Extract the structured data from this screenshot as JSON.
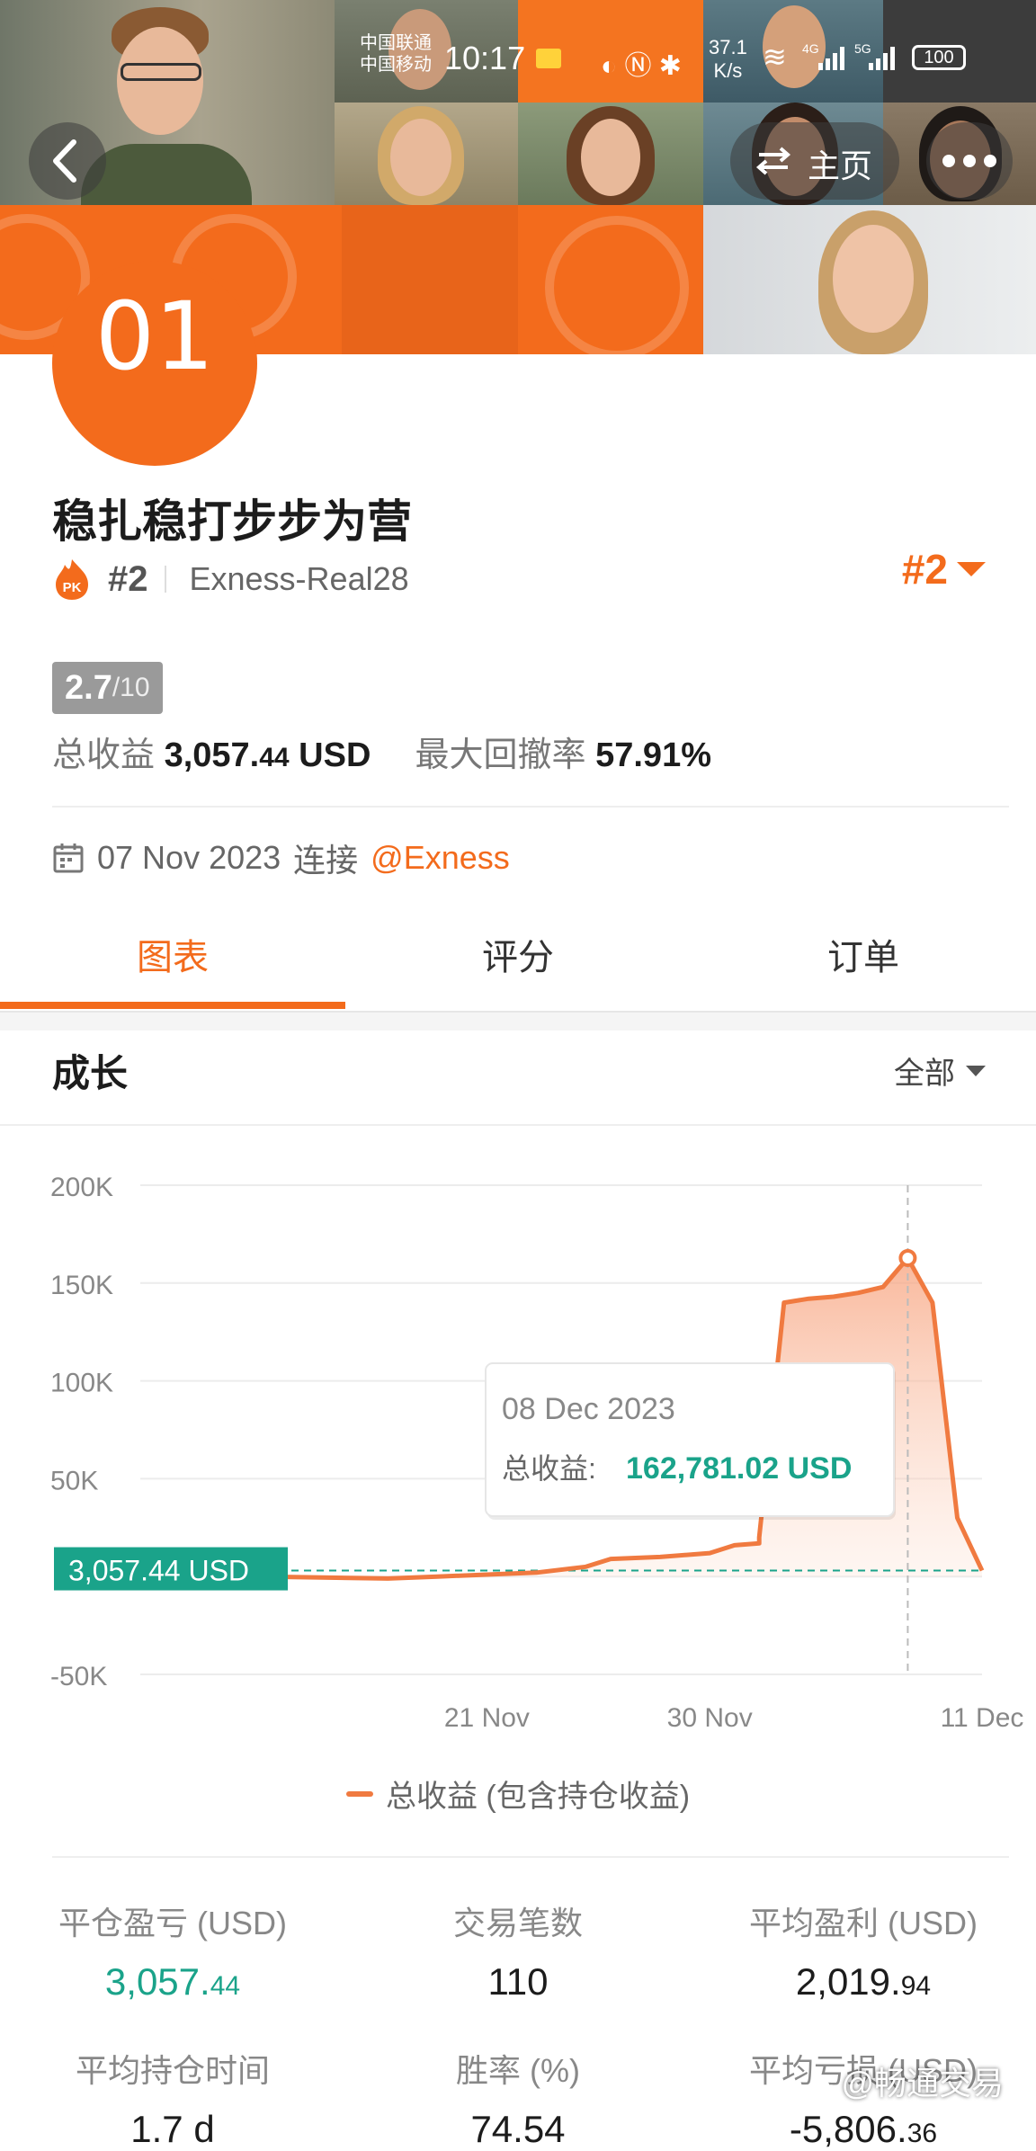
{
  "status_bar": {
    "carrier1": "中国联通",
    "carrier2": "中国移动",
    "time": "10:17",
    "speed_value": "37.1",
    "speed_unit": "K/s",
    "net_4g": "4G",
    "net_5g": "5G",
    "battery": "100"
  },
  "header": {
    "home_label": "主页",
    "rank_badge": "01"
  },
  "profile": {
    "title": "稳扎稳打步步为营",
    "pk_label": "PK",
    "rank": "#2",
    "server": "Exness-Real28",
    "rank_right": "#2",
    "score": "2.7",
    "score_max": "/10",
    "total_profit_label": "总收益",
    "total_profit_main": "3,057.",
    "total_profit_dec": "44",
    "total_profit_unit": "USD",
    "max_drawdown_label": "最大回撤率",
    "max_drawdown": "57.91%",
    "connect_date": "07 Nov 2023",
    "connect_label": "连接",
    "broker": "@Exness"
  },
  "tabs": [
    {
      "label": "图表",
      "active": true
    },
    {
      "label": "评分",
      "active": false
    },
    {
      "label": "订单",
      "active": false
    }
  ],
  "growth": {
    "title": "成长",
    "filter": "全部"
  },
  "chart_data": {
    "type": "area",
    "y_ticks": [
      "200K",
      "150K",
      "100K",
      "50K",
      "",
      "-50K"
    ],
    "ylim": [
      -50000,
      200000
    ],
    "x_tick_labels": [
      "21 Nov",
      "30 Nov",
      "11 Dec"
    ],
    "series": [
      {
        "name": "总收益 (包含持仓收益)",
        "color": "#f07a40",
        "points": [
          [
            "2023-11-07",
            0
          ],
          [
            "2023-11-12",
            0
          ],
          [
            "2023-11-17",
            -1000
          ],
          [
            "2023-11-19",
            0
          ],
          [
            "2023-11-23",
            2000
          ],
          [
            "2023-11-25",
            5000
          ],
          [
            "2023-11-26",
            9000
          ],
          [
            "2023-11-28",
            10000
          ],
          [
            "2023-11-30",
            12000
          ],
          [
            "2023-12-01",
            16000
          ],
          [
            "2023-12-02",
            17000
          ],
          [
            "2023-12-02",
            20000
          ],
          [
            "2023-12-03",
            140000
          ],
          [
            "2023-12-04",
            142000
          ],
          [
            "2023-12-05",
            143000
          ],
          [
            "2023-12-06",
            145000
          ],
          [
            "2023-12-07",
            148000
          ],
          [
            "2023-12-08",
            162781.02
          ],
          [
            "2023-12-09",
            140000
          ],
          [
            "2023-12-10",
            30000
          ],
          [
            "2023-12-11",
            3057.44
          ]
        ]
      }
    ],
    "current_value_label": "3,057.44 USD",
    "tooltip": {
      "date": "08 Dec 2023",
      "label": "总收益:",
      "value": "162,781.02 USD"
    },
    "legend": "总收益 (包含持仓收益)"
  },
  "metrics": [
    {
      "label": "平仓盈亏 (USD)",
      "main": "3,057.",
      "dec": "44",
      "green": true
    },
    {
      "label": "交易笔数",
      "main": "110",
      "dec": "",
      "green": false
    },
    {
      "label": "平均盈利 (USD)",
      "main": "2,019.",
      "dec": "94",
      "green": false
    },
    {
      "label": "平均持仓时间",
      "main": "1.7 d",
      "dec": "",
      "green": false
    },
    {
      "label": "胜率 (%)",
      "main": "74.54",
      "dec": "",
      "green": false
    },
    {
      "label": "平均亏损 (USD)",
      "main": "-5,806.",
      "dec": "36",
      "green": false
    }
  ],
  "watermark": "@畅通交易",
  "colors": {
    "accent": "#f36b1c",
    "green": "#1aa38a",
    "chart_line": "#f07a40"
  }
}
